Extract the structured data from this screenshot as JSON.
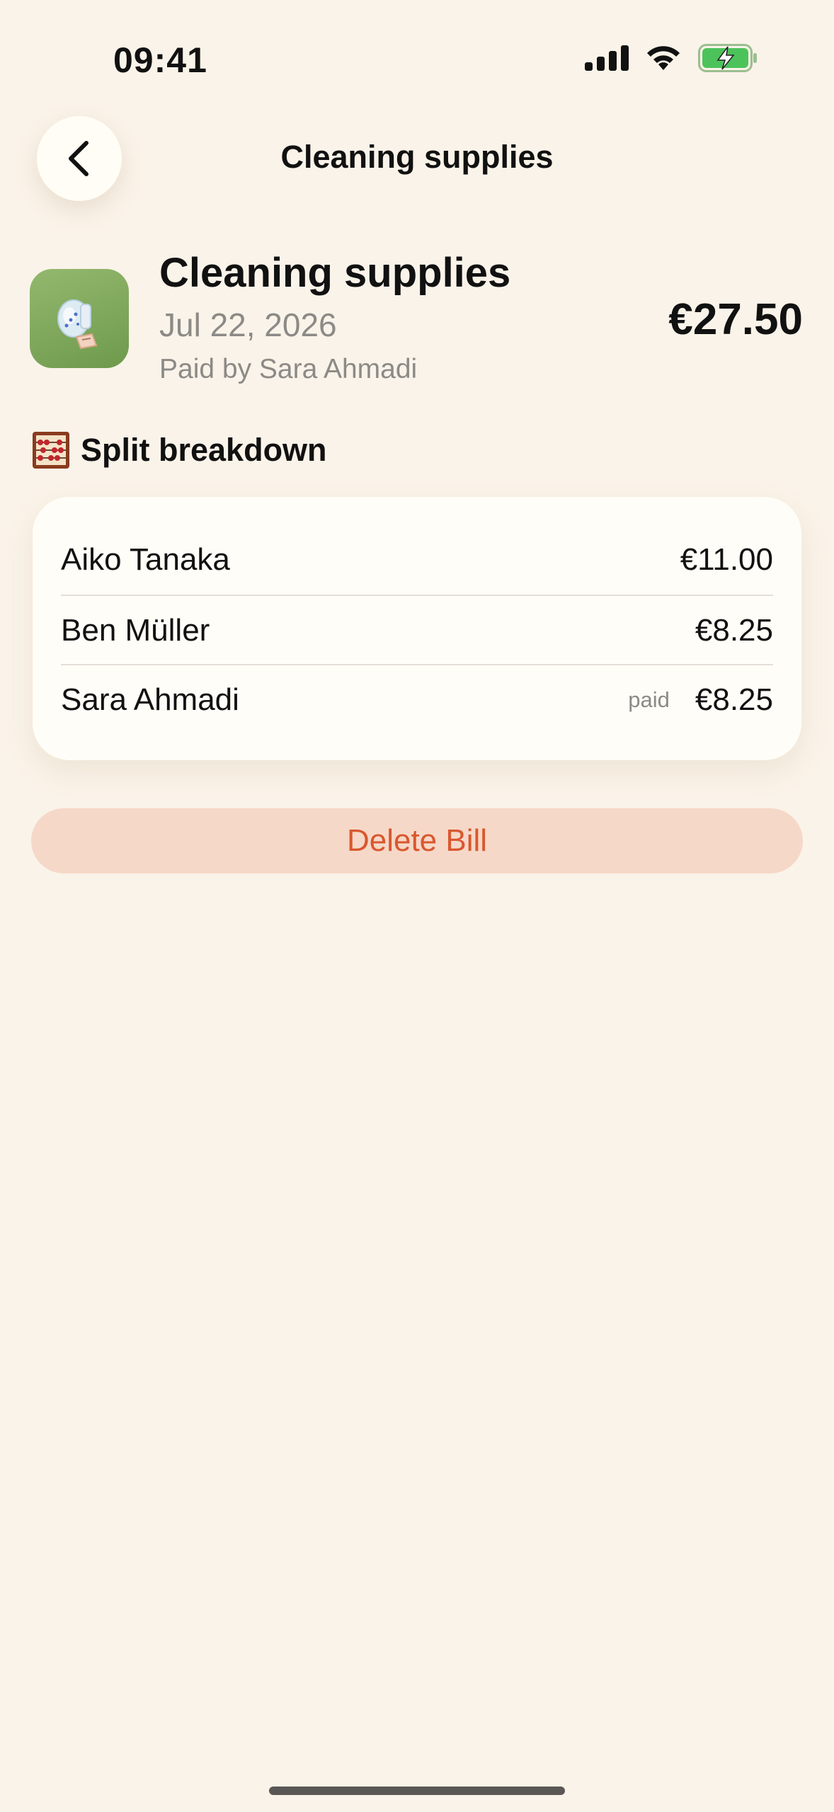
{
  "status_bar": {
    "time": "09:41"
  },
  "nav": {
    "title": "Cleaning supplies"
  },
  "bill": {
    "title": "Cleaning supplies",
    "date": "Jul 22, 2026",
    "paid_by": "Paid by Sara Ahmadi",
    "total": "€27.50"
  },
  "section": {
    "title": "Split breakdown",
    "icon": "abacus-icon"
  },
  "splits": [
    {
      "name": "Aiko Tanaka",
      "amount": "€11.00",
      "badge": ""
    },
    {
      "name": "Ben Müller",
      "amount": "€8.25",
      "badge": ""
    },
    {
      "name": "Sara Ahmadi",
      "amount": "€8.25",
      "badge": "paid"
    }
  ],
  "actions": {
    "delete_label": "Delete Bill"
  },
  "colors": {
    "background": "#FAF3E9",
    "card": "#FFFDF7",
    "icon_bg": "#7FA65B",
    "delete_bg": "#F6D8C8",
    "delete_text": "#D9572E",
    "secondary_text": "#8C8A86"
  }
}
